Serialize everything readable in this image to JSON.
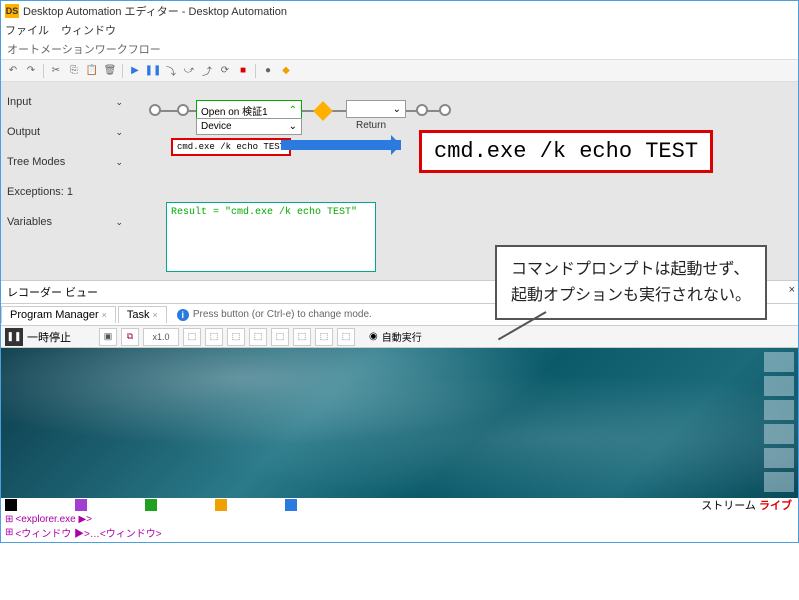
{
  "window": {
    "icon_text": "DS",
    "title": "Desktop Automation エディター - Desktop Automation"
  },
  "menubar": {
    "file": "ファイル",
    "window": "ウィンドウ"
  },
  "workflow_label": "オートメーションワークフロー",
  "side": {
    "input": "Input",
    "output": "Output",
    "tree_modes": "Tree Modes",
    "exceptions": "Exceptions: 1",
    "variables": "Variables"
  },
  "flow": {
    "open_on": "Open on 検証1",
    "device": "Device",
    "return": "Return",
    "cmd_small": "cmd.exe /k echo TEST",
    "cmd_big": "cmd.exe /k echo TEST",
    "result": "Result = \"cmd.exe /k echo TEST\""
  },
  "callout": {
    "line1": "コマンドプロンプトは起動せず、",
    "line2": "起動オプションも実行されない。"
  },
  "recorder": {
    "label": "レコーダー ビュー",
    "tab1": "Program Manager",
    "tab2": "Task",
    "hint": "Press button (or Ctrl-e) to change mode.",
    "pause": "一時停止",
    "speed": "x1.0",
    "auto": "自動実行"
  },
  "stream": {
    "label": "ストリーム",
    "live": "ライブ"
  },
  "tree": {
    "line1": "<explorer.exe ▶>",
    "line2": "<ウィンドウ ▶>…<ウィンドウ>"
  },
  "colors": [
    "#000000",
    "#a040d0",
    "#20a020",
    "#f0a000",
    "#2a7ae0"
  ]
}
